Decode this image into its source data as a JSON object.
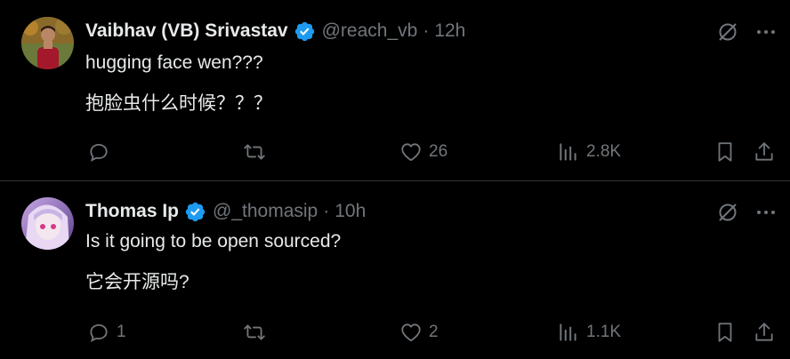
{
  "colors": {
    "background": "#000000",
    "text": "#e7e9ea",
    "muted": "#71767b",
    "verified": "#1d9bf0",
    "divider": "#2f3336"
  },
  "tweets": [
    {
      "name": "Vaibhav (VB) Srivastav",
      "handle": "@reach_vb",
      "separator": "·",
      "time": "12h",
      "line1": "hugging face wen???",
      "line2": "抱脸虫什么时候？？？",
      "reply_count": "",
      "retweet_count": "",
      "like_count": "26",
      "view_count": "2.8K",
      "icons": [
        "verified-badge-icon",
        "grok-icon",
        "more-icon",
        "reply-icon",
        "retweet-icon",
        "like-icon",
        "views-icon",
        "bookmark-icon",
        "share-icon"
      ]
    },
    {
      "name": "Thomas Ip",
      "handle": "@_thomasip",
      "separator": "·",
      "time": "10h",
      "line1": "Is it going to be open sourced?",
      "line2": "它会开源吗?",
      "reply_count": "1",
      "retweet_count": "",
      "like_count": "2",
      "view_count": "1.1K",
      "icons": [
        "verified-badge-icon",
        "grok-icon",
        "more-icon",
        "reply-icon",
        "retweet-icon",
        "like-icon",
        "views-icon",
        "bookmark-icon",
        "share-icon"
      ]
    }
  ]
}
